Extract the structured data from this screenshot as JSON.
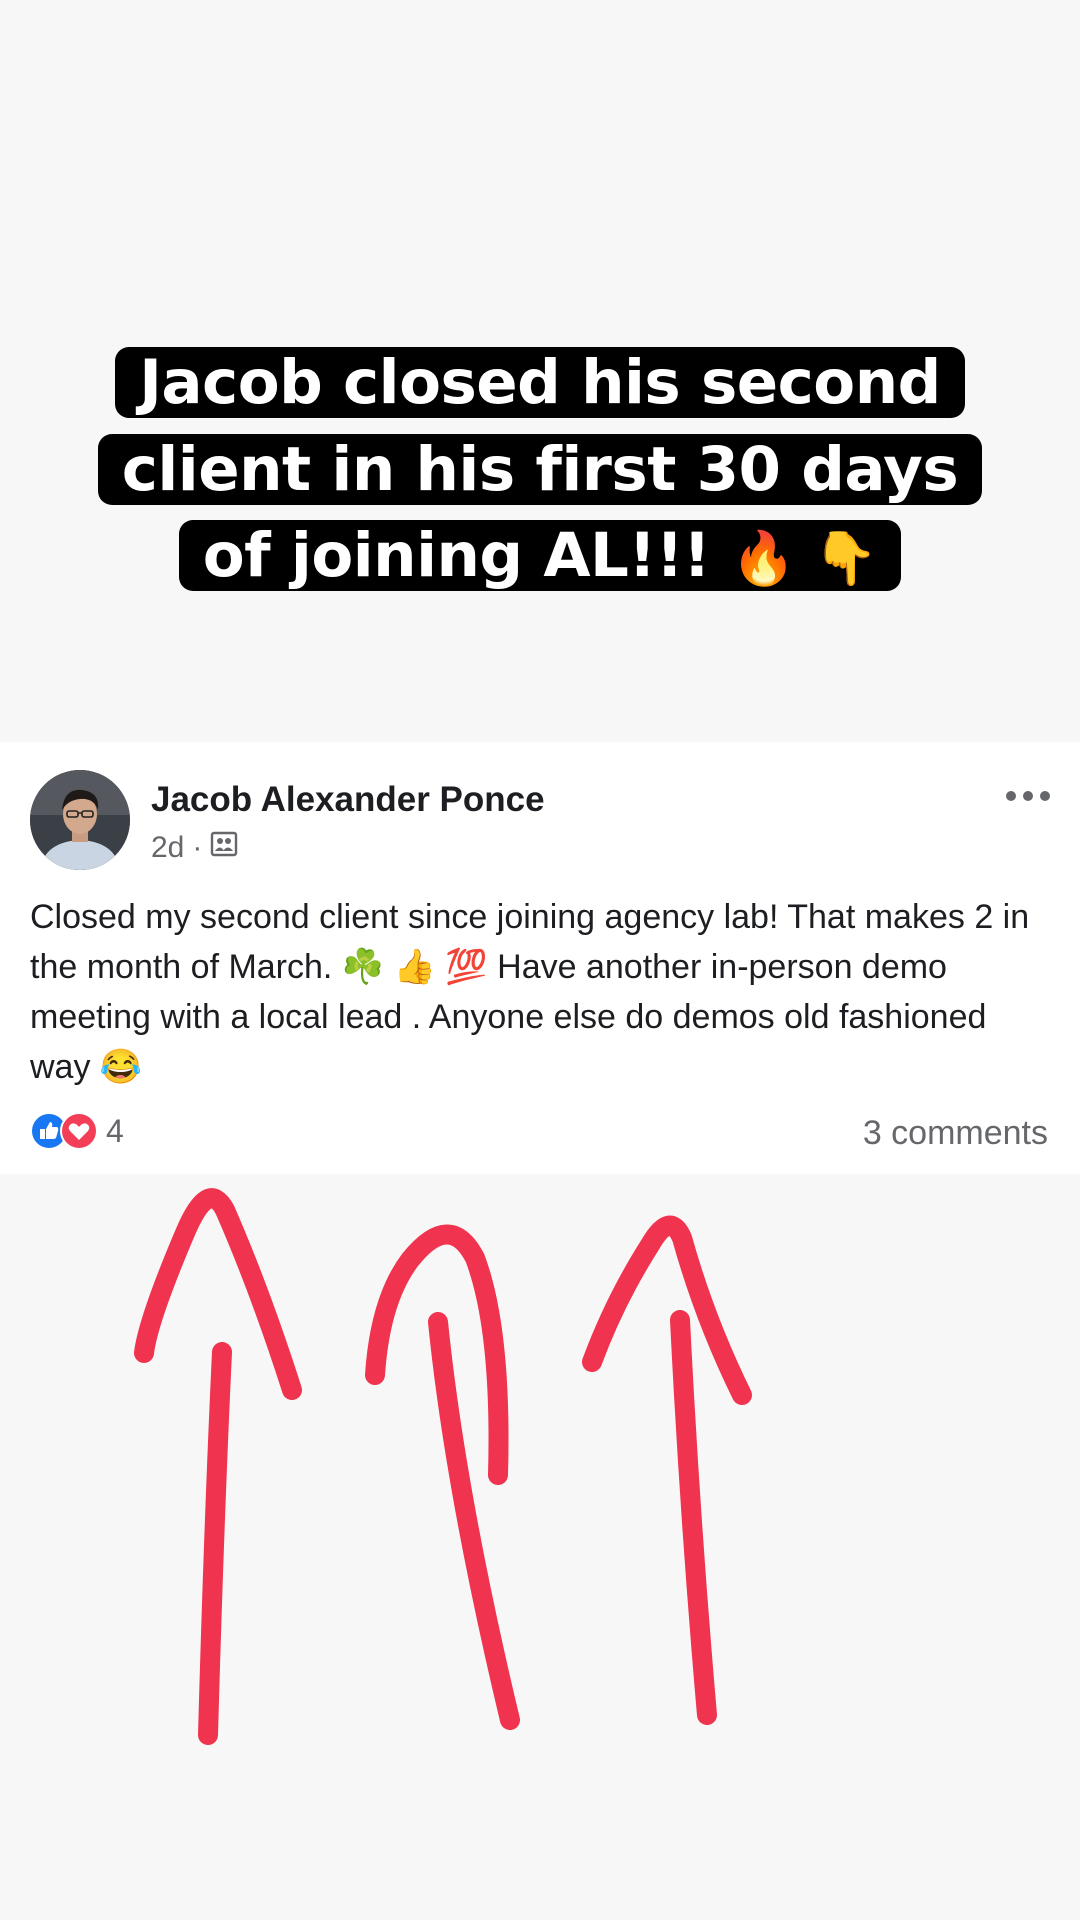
{
  "story": {
    "headline_lines": [
      "Jacob closed his second",
      "client in his first 30 days",
      "of joining AL!!!"
    ],
    "headline_emojis": "🔥 👇"
  },
  "post": {
    "author_name": "Jacob Alexander Ponce",
    "time_ago": "2d",
    "meta_separator": "·",
    "privacy_icon": "group-icon",
    "text": "Closed my second client since joining agency lab! That makes 2 in the month of March. ☘️ 👍 💯 Have another in-person demo meeting with a local lead . Anyone else do demos old fashioned way 😂",
    "reaction_icons": [
      "like-reaction-icon",
      "love-reaction-icon"
    ],
    "reaction_count": "4",
    "comments_label": "3 comments"
  },
  "annotation": {
    "arrow_color": "#f0334f",
    "arrow_count": 3
  },
  "colors": {
    "headline_bg": "#000000",
    "headline_text": "#ffffff",
    "facebook_blue": "#1877f2",
    "love_red": "#f33e58",
    "meta_gray": "#65676b"
  }
}
